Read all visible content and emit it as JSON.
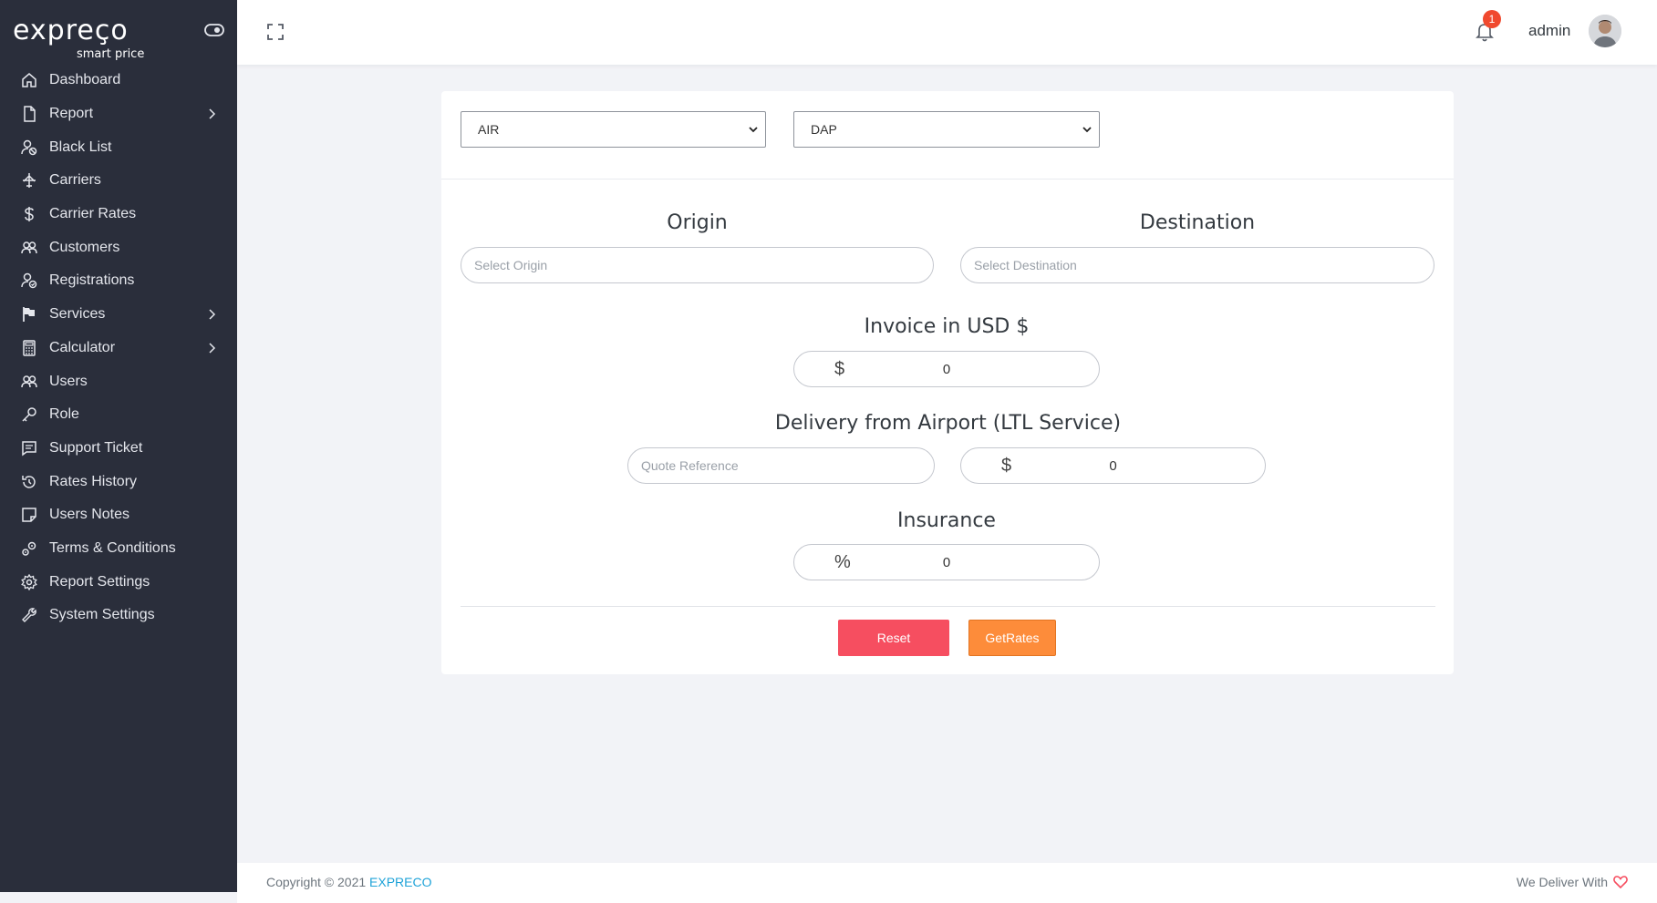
{
  "brand": {
    "name": "expreço",
    "tagline": "smart price"
  },
  "sidebar": {
    "items": [
      {
        "label": "Dashboard",
        "icon": "home-icon",
        "has_submenu": false
      },
      {
        "label": "Report",
        "icon": "file-icon",
        "has_submenu": true
      },
      {
        "label": "Black List",
        "icon": "user-block-icon",
        "has_submenu": false
      },
      {
        "label": "Carriers",
        "icon": "plane-icon",
        "has_submenu": false
      },
      {
        "label": "Carrier Rates",
        "icon": "dollar-icon",
        "has_submenu": false
      },
      {
        "label": "Customers",
        "icon": "users-icon",
        "has_submenu": false
      },
      {
        "label": "Registrations",
        "icon": "user-check-icon",
        "has_submenu": false
      },
      {
        "label": "Services",
        "icon": "flag-icon",
        "has_submenu": true
      },
      {
        "label": "Calculator",
        "icon": "calculator-icon",
        "has_submenu": true
      },
      {
        "label": "Users",
        "icon": "users-icon",
        "has_submenu": false
      },
      {
        "label": "Role",
        "icon": "key-icon",
        "has_submenu": false
      },
      {
        "label": "Support Ticket",
        "icon": "message-icon",
        "has_submenu": false
      },
      {
        "label": "Rates History",
        "icon": "history-icon",
        "has_submenu": false
      },
      {
        "label": "Users Notes",
        "icon": "note-icon",
        "has_submenu": false
      },
      {
        "label": "Terms & Conditions",
        "icon": "gears-icon",
        "has_submenu": false
      },
      {
        "label": "Report Settings",
        "icon": "gear-icon",
        "has_submenu": false
      },
      {
        "label": "System Settings",
        "icon": "wrench-icon",
        "has_submenu": false
      }
    ]
  },
  "topbar": {
    "notification_count": "1",
    "user_name": "admin"
  },
  "form": {
    "mode_select": "AIR",
    "incoterm_select": "DAP",
    "origin_heading": "Origin",
    "origin_placeholder": "Select Origin",
    "destination_heading": "Destination",
    "destination_placeholder": "Select Destination",
    "invoice_heading": "Invoice in USD $",
    "invoice_prefix": "$",
    "invoice_value": "0",
    "delivery_heading": "Delivery from Airport (LTL Service)",
    "quote_placeholder": "Quote Reference",
    "delivery_prefix": "$",
    "delivery_value": "0",
    "insurance_heading": "Insurance",
    "insurance_prefix": "%",
    "insurance_value": "0",
    "reset_label": "Reset",
    "getrates_label": "GetRates"
  },
  "footer": {
    "copyright": "Copyright © 2021 ",
    "brand": "EXPRECO",
    "deliver_text": "We Deliver With"
  },
  "colors": {
    "sidebar_bg": "#2a2e3b",
    "reset": "#f64e60",
    "getrates": "#fd8c3a",
    "badge": "#f0492e",
    "link": "#1fa3d8"
  }
}
